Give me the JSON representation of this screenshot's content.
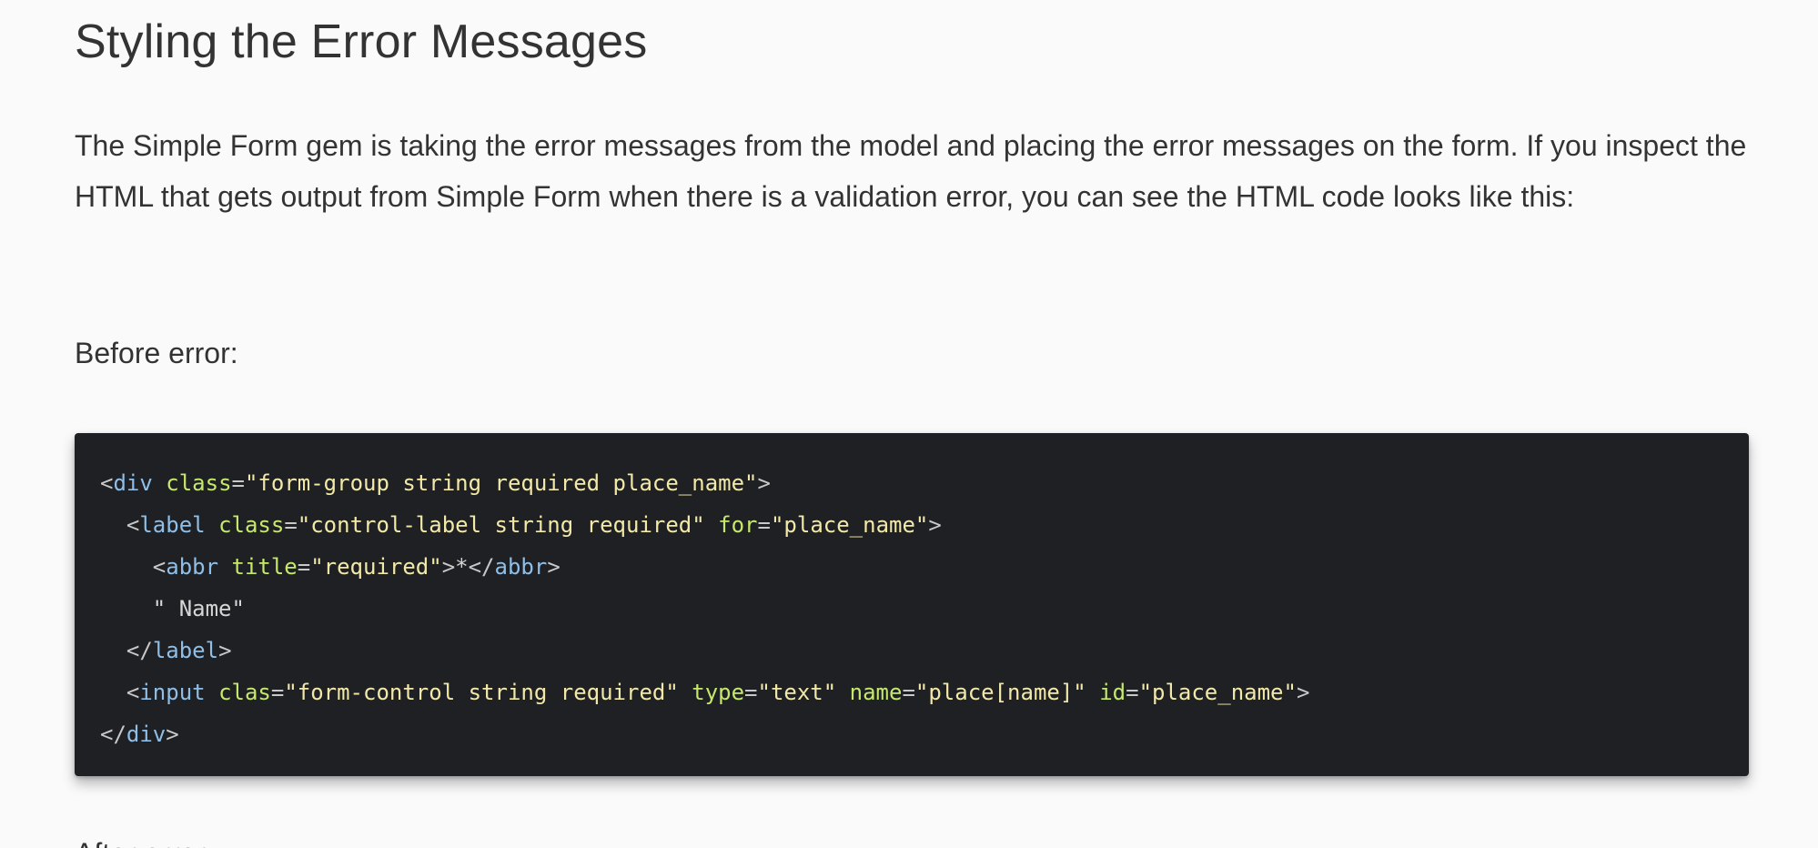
{
  "heading": "Styling the Error Messages",
  "intro": "The Simple Form gem is taking the error messages from the model and placing the error messages on the form. If you inspect the HTML that gets output from Simple Form when there is a validation error, you can see the HTML code looks like this:",
  "before_label": "Before error:",
  "next_text": "After error:",
  "code_lines": [
    [
      {
        "t": "punct",
        "v": "<"
      },
      {
        "t": "tag",
        "v": "div"
      },
      {
        "t": "text",
        "v": " "
      },
      {
        "t": "attr",
        "v": "class"
      },
      {
        "t": "punct",
        "v": "="
      },
      {
        "t": "str",
        "v": "\"form-group string required place_name\""
      },
      {
        "t": "punct",
        "v": ">"
      }
    ],
    [
      {
        "t": "text",
        "v": "  "
      },
      {
        "t": "punct",
        "v": "<"
      },
      {
        "t": "tag",
        "v": "label"
      },
      {
        "t": "text",
        "v": " "
      },
      {
        "t": "attr",
        "v": "class"
      },
      {
        "t": "punct",
        "v": "="
      },
      {
        "t": "str",
        "v": "\"control-label string required\""
      },
      {
        "t": "text",
        "v": " "
      },
      {
        "t": "attr",
        "v": "for"
      },
      {
        "t": "punct",
        "v": "="
      },
      {
        "t": "str",
        "v": "\"place_name\""
      },
      {
        "t": "punct",
        "v": ">"
      }
    ],
    [
      {
        "t": "text",
        "v": "    "
      },
      {
        "t": "punct",
        "v": "<"
      },
      {
        "t": "tag",
        "v": "abbr"
      },
      {
        "t": "text",
        "v": " "
      },
      {
        "t": "attr",
        "v": "title"
      },
      {
        "t": "punct",
        "v": "="
      },
      {
        "t": "str",
        "v": "\"required\""
      },
      {
        "t": "punct",
        "v": ">"
      },
      {
        "t": "text",
        "v": "*"
      },
      {
        "t": "punct",
        "v": "</"
      },
      {
        "t": "tag",
        "v": "abbr"
      },
      {
        "t": "punct",
        "v": ">"
      }
    ],
    [
      {
        "t": "text",
        "v": "    \" Name\""
      }
    ],
    [
      {
        "t": "text",
        "v": "  "
      },
      {
        "t": "punct",
        "v": "</"
      },
      {
        "t": "tag",
        "v": "label"
      },
      {
        "t": "punct",
        "v": ">"
      }
    ],
    [
      {
        "t": "text",
        "v": "  "
      },
      {
        "t": "punct",
        "v": "<"
      },
      {
        "t": "tag",
        "v": "input"
      },
      {
        "t": "text",
        "v": " "
      },
      {
        "t": "attr",
        "v": "clas"
      },
      {
        "t": "punct",
        "v": "="
      },
      {
        "t": "str",
        "v": "\"form-control string required\""
      },
      {
        "t": "text",
        "v": " "
      },
      {
        "t": "attr",
        "v": "type"
      },
      {
        "t": "punct",
        "v": "="
      },
      {
        "t": "str",
        "v": "\"text\""
      },
      {
        "t": "text",
        "v": " "
      },
      {
        "t": "attr",
        "v": "name"
      },
      {
        "t": "punct",
        "v": "="
      },
      {
        "t": "str",
        "v": "\"place[name]\""
      },
      {
        "t": "text",
        "v": " "
      },
      {
        "t": "attr",
        "v": "id"
      },
      {
        "t": "punct",
        "v": "="
      },
      {
        "t": "str",
        "v": "\"place_name\""
      },
      {
        "t": "punct",
        "v": ">"
      }
    ],
    [
      {
        "t": "punct",
        "v": "</"
      },
      {
        "t": "tag",
        "v": "div"
      },
      {
        "t": "punct",
        "v": ">"
      }
    ]
  ]
}
